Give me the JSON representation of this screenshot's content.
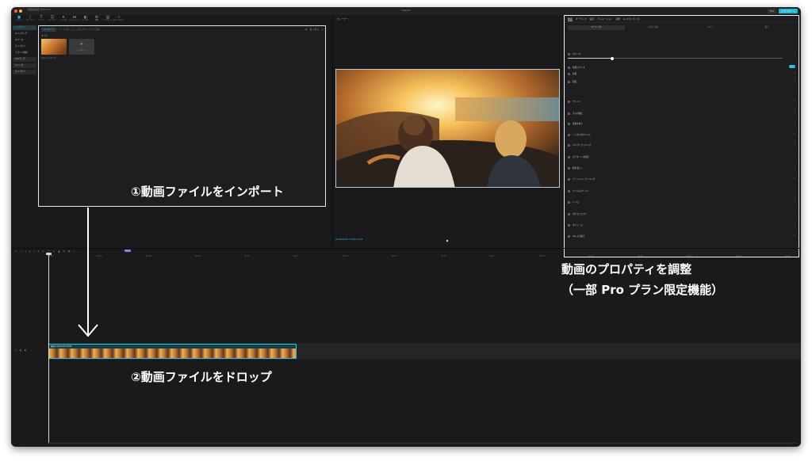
{
  "window": {
    "title": "名称未設定 0112 01",
    "center_title": "CapCut",
    "pro_label": "Pro",
    "export_label": "エクスポート"
  },
  "toolbar": {
    "items": [
      {
        "icon": "▣",
        "label": "メディア"
      },
      {
        "icon": "♪",
        "label": "オーディオ"
      },
      {
        "icon": "T",
        "label": "テキスト"
      },
      {
        "icon": "☺",
        "label": "ステッカー"
      },
      {
        "icon": "✦",
        "label": "エフェクト"
      },
      {
        "icon": "⋈",
        "label": "トランジション"
      },
      {
        "icon": "◐",
        "label": "フィルター"
      },
      {
        "icon": "⚙",
        "label": "調整"
      },
      {
        "icon": "▤",
        "label": "テンプレート"
      },
      {
        "icon": "✧",
        "label": "AIキャラクター"
      }
    ]
  },
  "sidebar": {
    "items": [
      "インポート",
      "マイメディア",
      "スペース",
      "ライブラリ",
      "ブランド素材",
      "AIメディア",
      "ストック",
      "ライブラリ"
    ]
  },
  "media": {
    "import_label": "インポート",
    "path": "ファイルをここに、またはクリックして追加",
    "sub": "すべて",
    "thumb_caption": "動画.mp4  00:12",
    "placeholder_label": "インポート",
    "tools": [
      "▤",
      "並べ替え",
      "▾"
    ]
  },
  "player": {
    "label": "プレーヤー",
    "time": "00:00:00:00 / 00:00:12:03"
  },
  "props": {
    "tabs": [
      "動画",
      "オーディオ",
      "速度",
      "アニメーション",
      "調整",
      "AI スタイライズ"
    ],
    "subtabs": [
      "ベーシック",
      "背景を削除",
      "マスク",
      "補正"
    ],
    "rows": [
      "スケール",
      "位置とサイズ",
      "位置",
      "回転",
      "ブレンド",
      "手ぶれ補正",
      "画質を向上",
      "ノイズリダクション",
      "カメラトラッキング",
      "ビデオノイズ除去",
      "肌を美しく",
      "モーショントラッキング",
      "フィルムグレイン",
      "レトロ",
      "ボケエフェクト",
      "ボリューム",
      "AIによる補正"
    ]
  },
  "timeline": {
    "ticks": [
      "00:00",
      "00:03",
      "00:06",
      "00:09",
      "00:12",
      "00:15",
      "00:18",
      "00:21",
      "00:24",
      "00:27",
      "00:30",
      "00:33",
      "00:36",
      "00:39",
      "00:42",
      "00:45"
    ],
    "clip_label": "動画.mp4  00:00:12:03"
  },
  "annotations": {
    "import": "①動画ファイルをインポート",
    "drop": "②動画ファイルをドロップ",
    "props_line1": "動画のプロパティを調整",
    "props_line2": "（一部 Pro プラン限定機能）"
  },
  "colors": {
    "accent": "#2bc4e0",
    "panel": "#1e1e20",
    "background": "#1a1a1c"
  }
}
